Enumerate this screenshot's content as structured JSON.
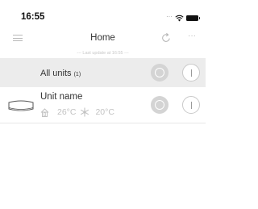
{
  "status_bar": {
    "time": "16:55"
  },
  "nav": {
    "title": "Home"
  },
  "last_update": "--- Last update at 16:55 ---",
  "all_units": {
    "label": "All units",
    "count": "(1)"
  },
  "unit": {
    "name": "Unit name",
    "indoor_temp": "26°C",
    "setpoint_temp": "20°C",
    "mode_icon": "snowflake-icon"
  },
  "colors": {
    "row_bg": "#ececec",
    "button_off": "#d4d4d4",
    "text": "#333333",
    "muted": "#c2c2c2"
  }
}
